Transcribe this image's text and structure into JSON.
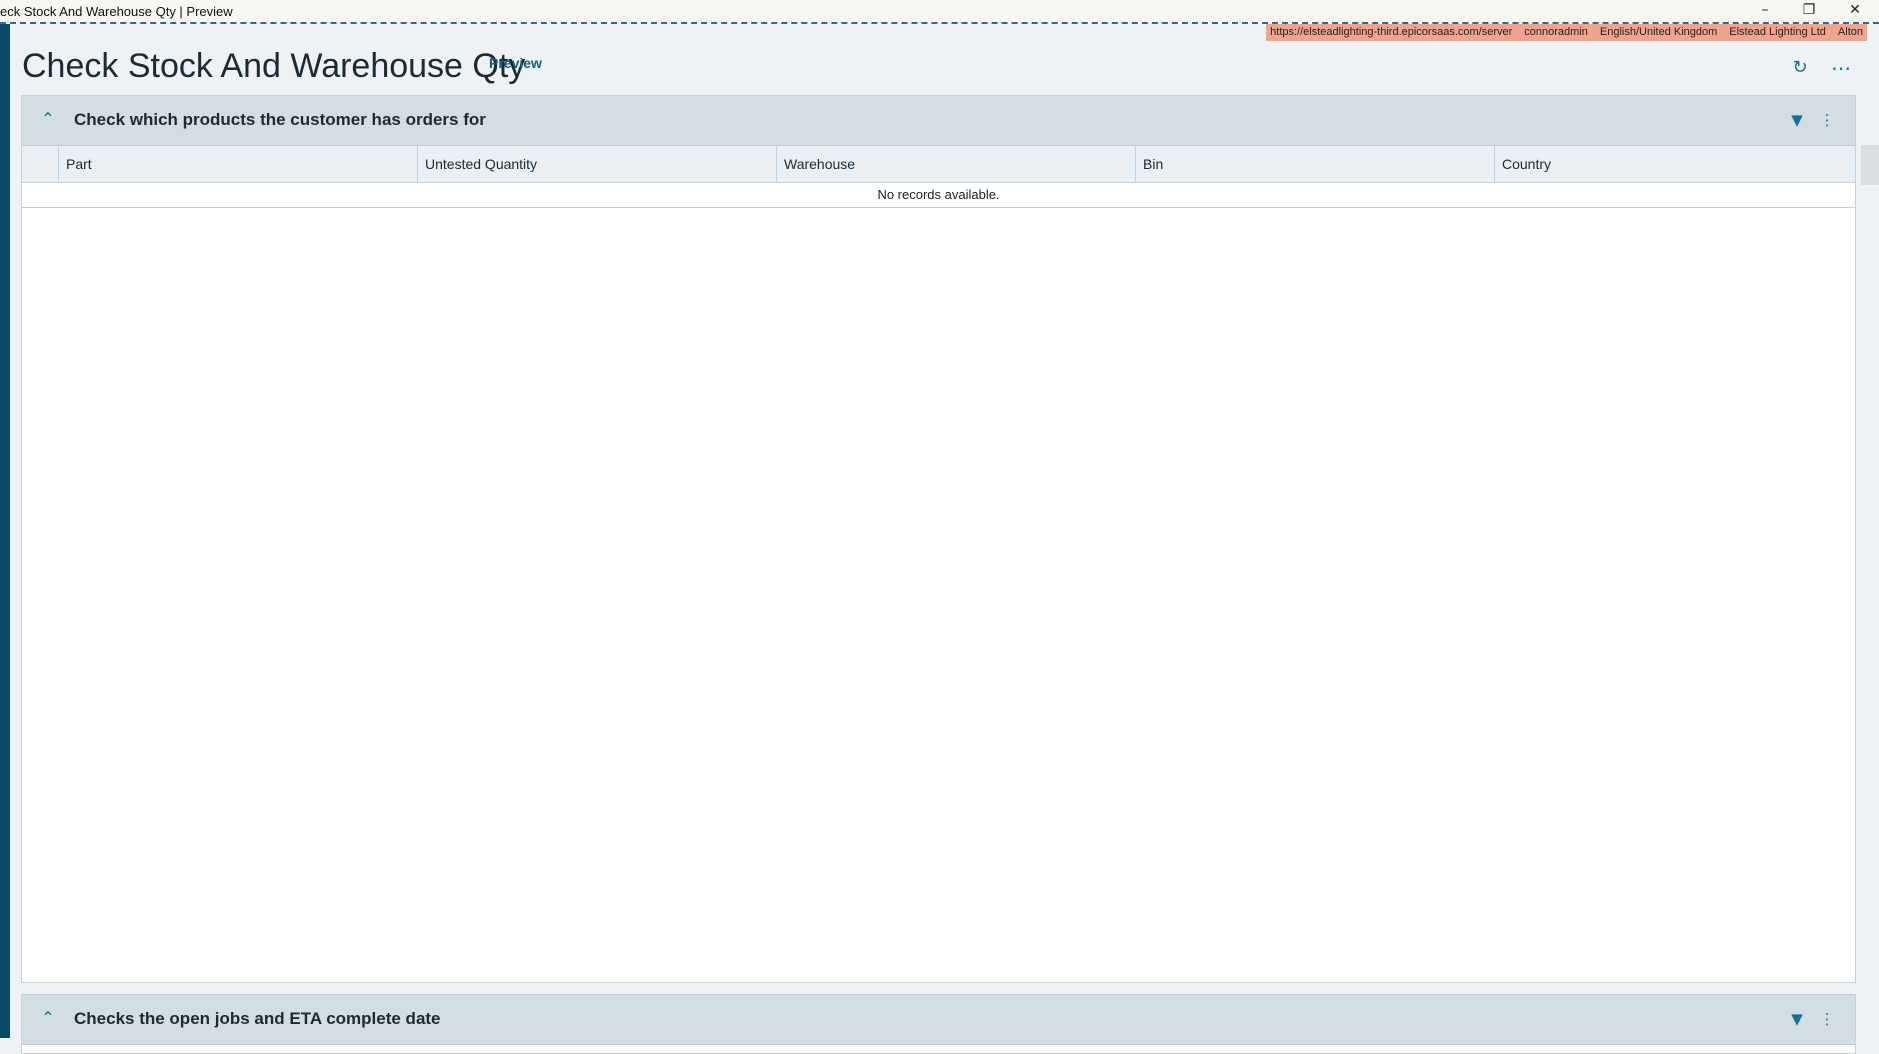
{
  "window": {
    "title": "eck Stock And Warehouse Qty | Preview",
    "minimize_icon": "minimize-icon",
    "restore_icon": "restore-icon",
    "close_icon": "close-icon"
  },
  "env": {
    "server": "https://elsteadlighting-third.epicorsaas.com/server",
    "user": "connoradmin",
    "language": "English/United Kingdom",
    "company": "Elstead Lighting Ltd",
    "site": "Alton"
  },
  "page": {
    "title": "Check Stock And Warehouse Qty",
    "badge": "Preview",
    "refresh_icon": "refresh-icon",
    "more_icon": "more-horizontal-icon"
  },
  "panels": [
    {
      "title": "Check which products the customer has orders for",
      "collapsed": false,
      "columns": [
        "Part",
        "Untested Quantity",
        "Warehouse",
        "Bin",
        "Country"
      ],
      "empty_text": "No records available."
    },
    {
      "title": "Checks the open jobs and ETA complete date",
      "collapsed": false
    }
  ],
  "colors": {
    "accent": "#1b6f96",
    "left_bar": "#0b4a66",
    "env_bar": "#f2a38e",
    "panel_header": "#d3dee3"
  }
}
